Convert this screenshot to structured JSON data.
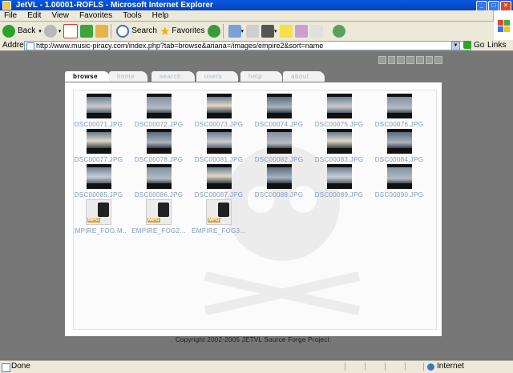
{
  "window": {
    "title": "JetVL - 1.00001-ROFLS - Microsoft Internet Explorer",
    "minimize": "_",
    "maximize": "□",
    "close": "×"
  },
  "menu": [
    "File",
    "Edit",
    "View",
    "Favorites",
    "Tools",
    "Help"
  ],
  "toolbar": {
    "back_label": "Back",
    "search_label": "Search",
    "favorites_label": "Favorites"
  },
  "address": {
    "label": "Address",
    "url": "http://www.music-piracy.com/index.php?tab=browse&ariana=/images/empire2&sort=name",
    "go_label": "Go",
    "links_label": "Links"
  },
  "tabs": [
    {
      "label": "browse",
      "active": true
    },
    {
      "label": "home",
      "active": false
    },
    {
      "label": "search",
      "active": false
    },
    {
      "label": "users",
      "active": false
    },
    {
      "label": "help",
      "active": false
    },
    {
      "label": "about",
      "active": false
    }
  ],
  "files": [
    {
      "name": "DSC00071.JPG",
      "kind": "image"
    },
    {
      "name": "DSC00072.JPG",
      "kind": "image"
    },
    {
      "name": "DSC00073.JPG",
      "kind": "image"
    },
    {
      "name": "DSC00074.JPG",
      "kind": "image"
    },
    {
      "name": "DSC00075.JPG",
      "kind": "image"
    },
    {
      "name": "DSC00076.JPG",
      "kind": "image"
    },
    {
      "name": "DSC00077.JPG",
      "kind": "image"
    },
    {
      "name": "DSC00078.JPG",
      "kind": "image"
    },
    {
      "name": "DSC00081.JPG",
      "kind": "image"
    },
    {
      "name": "DSC00082.JPG",
      "kind": "image"
    },
    {
      "name": "DSC00083.JPG",
      "kind": "image"
    },
    {
      "name": "DSC00084.JPG",
      "kind": "image"
    },
    {
      "name": "DSC00085.JPG",
      "kind": "image"
    },
    {
      "name": "DSC00086.JPG",
      "kind": "image"
    },
    {
      "name": "DSC00087.JPG",
      "kind": "image"
    },
    {
      "name": "DSC00088.JPG",
      "kind": "image"
    },
    {
      "name": "DSC00089.JPG",
      "kind": "image"
    },
    {
      "name": "DSC00090.JPG",
      "kind": "image"
    },
    {
      "name": "EMPIRE_FOG.M...",
      "kind": "video",
      "badge": "MPG"
    },
    {
      "name": "EMPIRE_FOG2...",
      "kind": "video",
      "badge": "MPG"
    },
    {
      "name": "EMPIRE_FOG3...",
      "kind": "video",
      "badge": "MPG"
    }
  ],
  "footer": {
    "copyright": "Copyright 2002-2005 JETVL Source Forge Project"
  },
  "status": {
    "text": "Done",
    "zone": "Internet"
  },
  "colors": {
    "title_bar": "#0a58e0",
    "content_bg": "#777777",
    "caption": "#7d9ac0",
    "tab_inactive_text": "#aeb9c8"
  }
}
